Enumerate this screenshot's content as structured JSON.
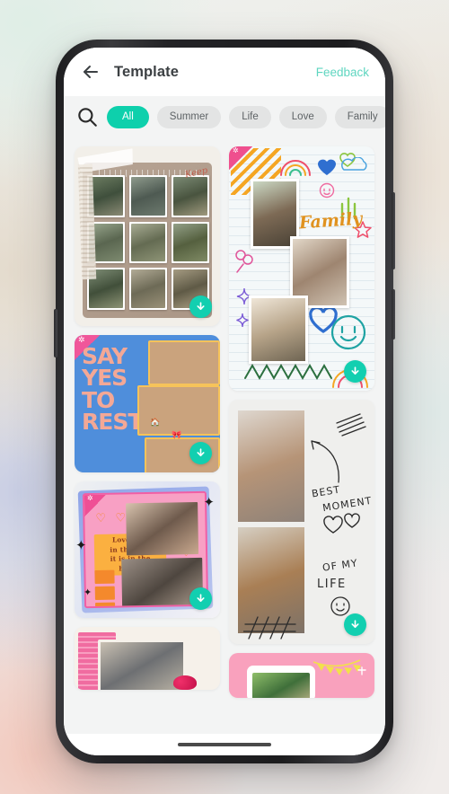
{
  "app": {
    "header": {
      "back_icon": "back-arrow-icon",
      "title": "Template",
      "feedback_label": "Feedback",
      "feedback_color": "#5fd6c0"
    },
    "filters": {
      "search_icon": "search-icon",
      "active_color": "#0ed0ac",
      "chips": [
        {
          "label": "All",
          "active": true
        },
        {
          "label": "Summer",
          "active": false
        },
        {
          "label": "Life",
          "active": false
        },
        {
          "label": "Love",
          "active": false
        },
        {
          "label": "Family",
          "active": false
        }
      ]
    },
    "download_icon": "download-arrow-icon",
    "download_color": "#12cfb0",
    "templates": {
      "grid_nine": {
        "name": "nine-photo-grid-template",
        "accent_text": "Keep"
      },
      "say_yes": {
        "name": "say-yes-to-rest-template",
        "lines": [
          "SAY",
          "YES",
          "TO",
          "REST"
        ]
      },
      "love_heart": {
        "name": "love-heart-template",
        "quote_lines": [
          "Love, not",
          "in the eye,",
          "it is in the",
          "heart."
        ]
      },
      "family": {
        "name": "family-doodle-template",
        "word": "Family"
      },
      "best_moment": {
        "name": "best-moment-template",
        "line1": "BEST",
        "line2": "MOMENT",
        "line3": "OF  MY",
        "line4": "LIFE"
      },
      "wedding": {
        "name": "wedding-template"
      },
      "party": {
        "name": "party-template"
      }
    },
    "system": {
      "home_indicator": "home-indicator"
    }
  }
}
